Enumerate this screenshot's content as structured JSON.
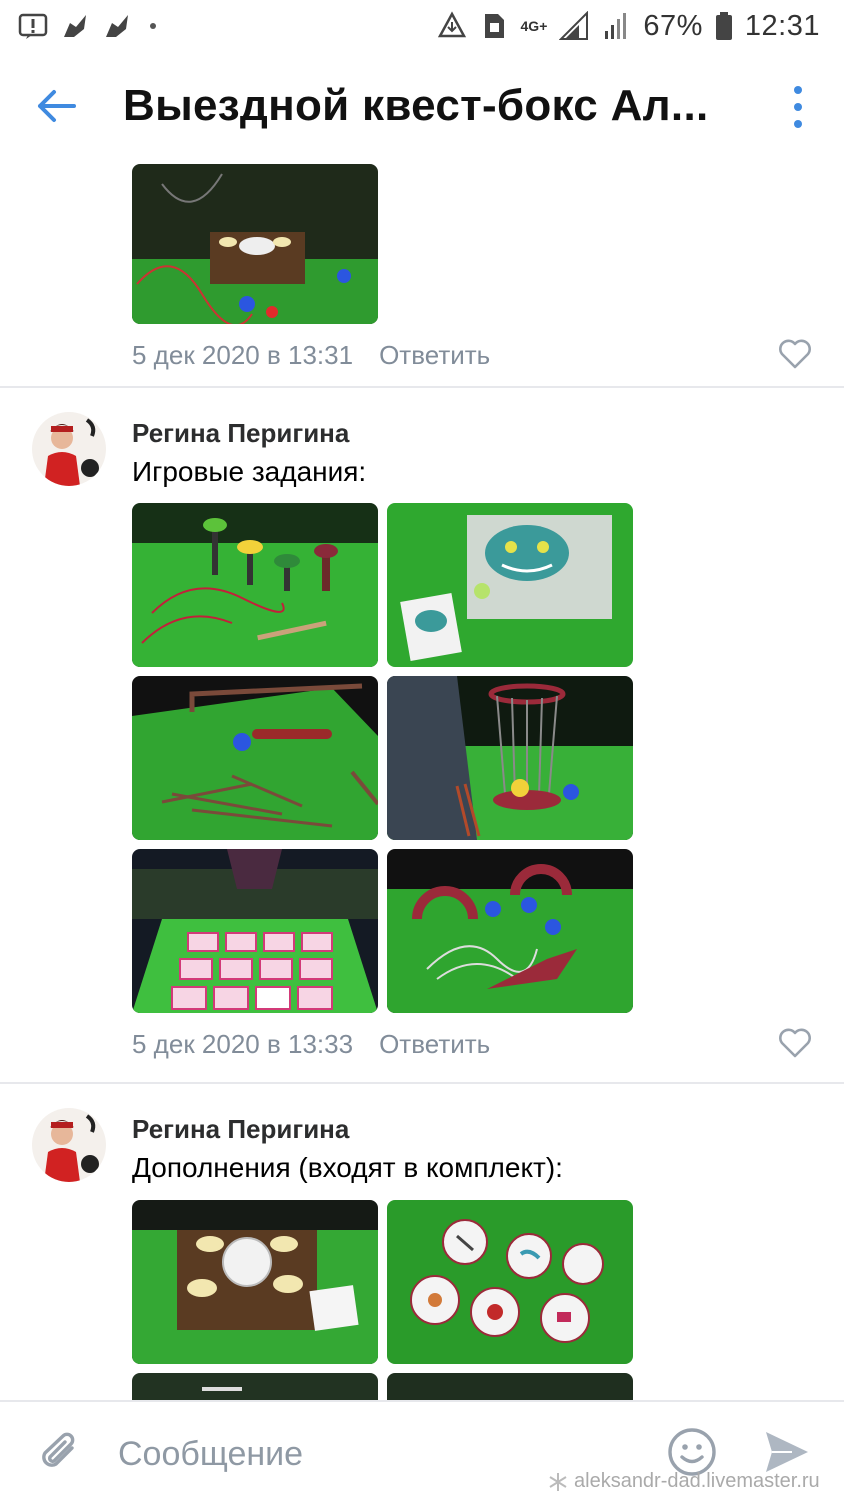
{
  "status_bar": {
    "network": "4G+",
    "battery": "67%",
    "time": "12:31"
  },
  "header": {
    "title": "Выездной квест-бокс Ал..."
  },
  "comments": [
    {
      "date": "5 дек 2020 в 13:31",
      "reply_label": "Ответить"
    },
    {
      "author": "Регина Перигина",
      "text": "Игровые задания:",
      "date": "5 дек 2020 в 13:33",
      "reply_label": "Ответить"
    },
    {
      "author": "Регина Перигина",
      "text": "Дополнения (входят в комплект):"
    }
  ],
  "composer": {
    "placeholder": "Сообщение"
  },
  "watermark": "aleksandr-dad.livemaster.ru",
  "colors": {
    "accent": "#3f8ae0",
    "meta": "#818c99",
    "divider": "#e7e8ec",
    "grass": "#2fa82f"
  },
  "icons": {
    "back": "arrow-left-icon",
    "more": "more-vertical-icon",
    "like": "heart-icon",
    "attach": "paperclip-icon",
    "emoji": "smile-icon",
    "send": "send-icon"
  }
}
